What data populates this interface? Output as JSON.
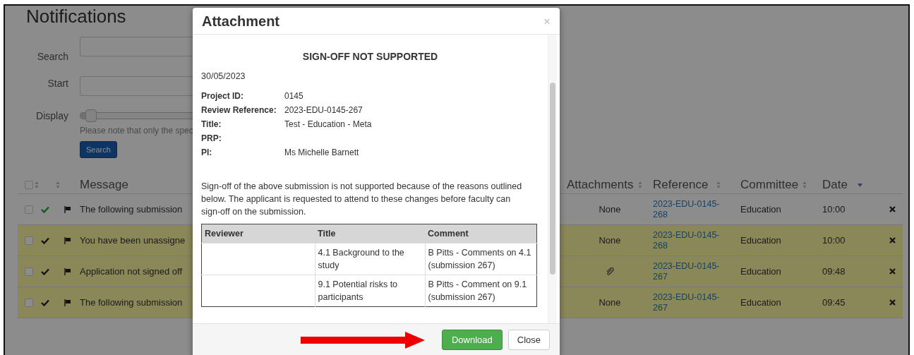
{
  "page": {
    "title": "Notifications"
  },
  "filters": {
    "search": {
      "label": "Search"
    },
    "start": {
      "label": "Start"
    },
    "display": {
      "label": "Display",
      "level": 0.06
    },
    "note": "Please note that only the spec",
    "button": "Search"
  },
  "table": {
    "select_all": {
      "checked": false
    },
    "columns": [
      "Message",
      "Attachments",
      "Reference",
      "Committee",
      "Date"
    ],
    "rows": [
      {
        "checked": false,
        "highlighted": false,
        "message": "The following submission",
        "attachments": "None",
        "reference": "2023-EDU-0145-268",
        "committee": "Education",
        "date": "10:00"
      },
      {
        "checked": false,
        "highlighted": true,
        "message": "You have been unassigne",
        "attachments": "None",
        "reference": "2023-EDU-0145-268",
        "committee": "Education",
        "date": "10:00"
      },
      {
        "checked": false,
        "highlighted": true,
        "message": "Application not signed off",
        "attachment_icon": true,
        "reference": "2023-EDU-0145-267",
        "committee": "Education",
        "date": "09:48"
      },
      {
        "checked": false,
        "highlighted": true,
        "message": "The following submission",
        "attachments": "None",
        "reference": "2023-EDU-0145-267",
        "committee": "Education",
        "date": "09:45"
      }
    ]
  },
  "modal": {
    "title": "Attachment",
    "close": "×",
    "heading": "SIGN-OFF NOT SUPPORTED",
    "date": "30/05/2023",
    "fields": [
      {
        "label": "Project ID:",
        "value": "0145"
      },
      {
        "label": "Review Reference:",
        "value": "2023-EDU-0145-267"
      },
      {
        "label": "Title:",
        "value": "Test - Education - Meta"
      },
      {
        "label": "PRP:"
      },
      {
        "label": "PI:",
        "value": "Ms Michelle Barnett"
      }
    ],
    "paragraph": "Sign-off of the above submission is not supported because of the reasons outlined below. The applicant is requested to attend to these changes before faculty can sign-off on the submission.",
    "table": {
      "columns": [
        "Reviewer",
        "Title",
        "Comment"
      ],
      "rows": [
        {
          "title": "4.1 Background to the study",
          "comment": "B Pitts - Comments on 4.1 (submission 267)"
        },
        {
          "title": "9.1 Potential risks to participants",
          "comment": "B Pitts - Comment on 9.1 (submission 267)"
        }
      ]
    },
    "buttons": [
      {
        "label": "Download",
        "kind": "primary"
      },
      {
        "label": "Close",
        "kind": "default"
      }
    ]
  }
}
